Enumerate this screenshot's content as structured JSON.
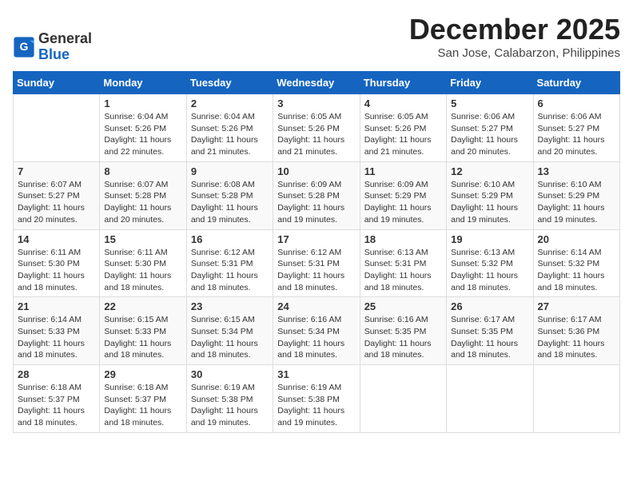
{
  "header": {
    "logo_line1": "General",
    "logo_line2": "Blue",
    "month": "December 2025",
    "location": "San Jose, Calabarzon, Philippines"
  },
  "days_of_week": [
    "Sunday",
    "Monday",
    "Tuesday",
    "Wednesday",
    "Thursday",
    "Friday",
    "Saturday"
  ],
  "weeks": [
    [
      {
        "day": "",
        "info": ""
      },
      {
        "day": "1",
        "info": "Sunrise: 6:04 AM\nSunset: 5:26 PM\nDaylight: 11 hours\nand 22 minutes."
      },
      {
        "day": "2",
        "info": "Sunrise: 6:04 AM\nSunset: 5:26 PM\nDaylight: 11 hours\nand 21 minutes."
      },
      {
        "day": "3",
        "info": "Sunrise: 6:05 AM\nSunset: 5:26 PM\nDaylight: 11 hours\nand 21 minutes."
      },
      {
        "day": "4",
        "info": "Sunrise: 6:05 AM\nSunset: 5:26 PM\nDaylight: 11 hours\nand 21 minutes."
      },
      {
        "day": "5",
        "info": "Sunrise: 6:06 AM\nSunset: 5:27 PM\nDaylight: 11 hours\nand 20 minutes."
      },
      {
        "day": "6",
        "info": "Sunrise: 6:06 AM\nSunset: 5:27 PM\nDaylight: 11 hours\nand 20 minutes."
      }
    ],
    [
      {
        "day": "7",
        "info": "Sunrise: 6:07 AM\nSunset: 5:27 PM\nDaylight: 11 hours\nand 20 minutes."
      },
      {
        "day": "8",
        "info": "Sunrise: 6:07 AM\nSunset: 5:28 PM\nDaylight: 11 hours\nand 20 minutes."
      },
      {
        "day": "9",
        "info": "Sunrise: 6:08 AM\nSunset: 5:28 PM\nDaylight: 11 hours\nand 19 minutes."
      },
      {
        "day": "10",
        "info": "Sunrise: 6:09 AM\nSunset: 5:28 PM\nDaylight: 11 hours\nand 19 minutes."
      },
      {
        "day": "11",
        "info": "Sunrise: 6:09 AM\nSunset: 5:29 PM\nDaylight: 11 hours\nand 19 minutes."
      },
      {
        "day": "12",
        "info": "Sunrise: 6:10 AM\nSunset: 5:29 PM\nDaylight: 11 hours\nand 19 minutes."
      },
      {
        "day": "13",
        "info": "Sunrise: 6:10 AM\nSunset: 5:29 PM\nDaylight: 11 hours\nand 19 minutes."
      }
    ],
    [
      {
        "day": "14",
        "info": "Sunrise: 6:11 AM\nSunset: 5:30 PM\nDaylight: 11 hours\nand 18 minutes."
      },
      {
        "day": "15",
        "info": "Sunrise: 6:11 AM\nSunset: 5:30 PM\nDaylight: 11 hours\nand 18 minutes."
      },
      {
        "day": "16",
        "info": "Sunrise: 6:12 AM\nSunset: 5:31 PM\nDaylight: 11 hours\nand 18 minutes."
      },
      {
        "day": "17",
        "info": "Sunrise: 6:12 AM\nSunset: 5:31 PM\nDaylight: 11 hours\nand 18 minutes."
      },
      {
        "day": "18",
        "info": "Sunrise: 6:13 AM\nSunset: 5:31 PM\nDaylight: 11 hours\nand 18 minutes."
      },
      {
        "day": "19",
        "info": "Sunrise: 6:13 AM\nSunset: 5:32 PM\nDaylight: 11 hours\nand 18 minutes."
      },
      {
        "day": "20",
        "info": "Sunrise: 6:14 AM\nSunset: 5:32 PM\nDaylight: 11 hours\nand 18 minutes."
      }
    ],
    [
      {
        "day": "21",
        "info": "Sunrise: 6:14 AM\nSunset: 5:33 PM\nDaylight: 11 hours\nand 18 minutes."
      },
      {
        "day": "22",
        "info": "Sunrise: 6:15 AM\nSunset: 5:33 PM\nDaylight: 11 hours\nand 18 minutes."
      },
      {
        "day": "23",
        "info": "Sunrise: 6:15 AM\nSunset: 5:34 PM\nDaylight: 11 hours\nand 18 minutes."
      },
      {
        "day": "24",
        "info": "Sunrise: 6:16 AM\nSunset: 5:34 PM\nDaylight: 11 hours\nand 18 minutes."
      },
      {
        "day": "25",
        "info": "Sunrise: 6:16 AM\nSunset: 5:35 PM\nDaylight: 11 hours\nand 18 minutes."
      },
      {
        "day": "26",
        "info": "Sunrise: 6:17 AM\nSunset: 5:35 PM\nDaylight: 11 hours\nand 18 minutes."
      },
      {
        "day": "27",
        "info": "Sunrise: 6:17 AM\nSunset: 5:36 PM\nDaylight: 11 hours\nand 18 minutes."
      }
    ],
    [
      {
        "day": "28",
        "info": "Sunrise: 6:18 AM\nSunset: 5:37 PM\nDaylight: 11 hours\nand 18 minutes."
      },
      {
        "day": "29",
        "info": "Sunrise: 6:18 AM\nSunset: 5:37 PM\nDaylight: 11 hours\nand 18 minutes."
      },
      {
        "day": "30",
        "info": "Sunrise: 6:19 AM\nSunset: 5:38 PM\nDaylight: 11 hours\nand 19 minutes."
      },
      {
        "day": "31",
        "info": "Sunrise: 6:19 AM\nSunset: 5:38 PM\nDaylight: 11 hours\nand 19 minutes."
      },
      {
        "day": "",
        "info": ""
      },
      {
        "day": "",
        "info": ""
      },
      {
        "day": "",
        "info": ""
      }
    ]
  ]
}
